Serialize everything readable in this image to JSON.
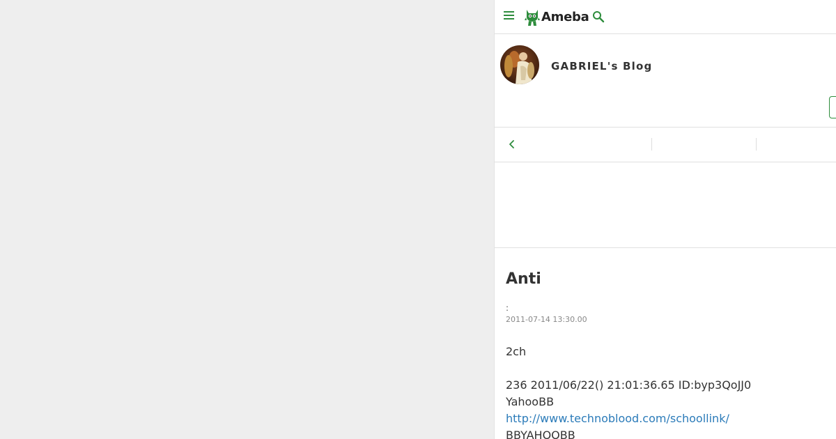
{
  "header": {
    "logo_text": "Ameba",
    "menu_icon": "hamburger-menu-icon",
    "search_icon": "search-icon"
  },
  "blog": {
    "title": "GABRIEL's Blog"
  },
  "article": {
    "title": "Anti",
    "theme": ":",
    "date": "2011-07-14 13:30.00",
    "paragraphs": {
      "p1": "2ch",
      "p2": "236 2011/06/22() 21:01:36.65 ID:byp3QoJJ0",
      "p3": "YahooBB",
      "link": "http://www.technoblood.com/schoollink/",
      "p4": "BBYAHOOBB"
    }
  },
  "colors": {
    "accent": "#2d8c3c",
    "link": "#2b7bb9",
    "background": "#eeeeee"
  }
}
